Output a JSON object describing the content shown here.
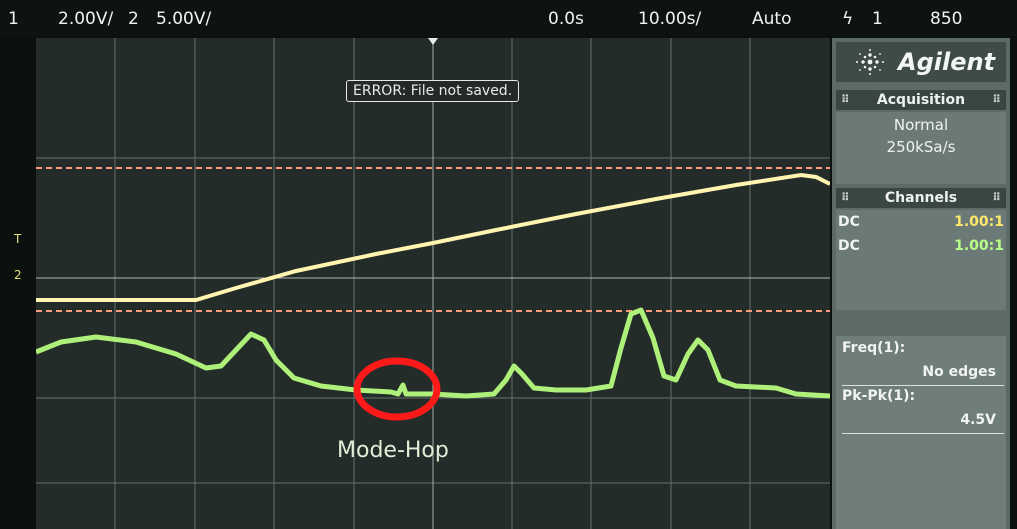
{
  "top_bar": {
    "ch1_num": "1",
    "ch1_scale": "2.00V/",
    "ch2_num": "2",
    "ch2_scale": "5.00V/",
    "time_offset": "0.0s",
    "time_scale": "10.00s/",
    "trigger_mode": "Auto",
    "trigger_source": "1",
    "trigger_level": "850"
  },
  "message": {
    "error": "ERROR: File not saved."
  },
  "annotation": {
    "label": "Mode-Hop"
  },
  "side_markers": {
    "marker1": "T",
    "marker2": "2"
  },
  "panel": {
    "brand": "Agilent",
    "acquisition": {
      "title": "Acquisition",
      "mode": "Normal",
      "rate": "250kSa/s"
    },
    "channels": {
      "title": "Channels",
      "rows": [
        {
          "coupling": "DC",
          "probe": "1.00:1"
        },
        {
          "coupling": "DC",
          "probe": "1.00:1"
        }
      ]
    },
    "measurements": [
      {
        "label": "Freq(1):",
        "value": "No edges"
      },
      {
        "label": "Pk-Pk(1):",
        "value": "4.5V"
      }
    ]
  },
  "colors": {
    "ch1_trace": "#aef07a",
    "ch2_trace": "#fff5b0",
    "cursor": "#ff9a7a",
    "highlight_circle": "#ff1a1a",
    "grid": "#9aa6a2"
  }
}
